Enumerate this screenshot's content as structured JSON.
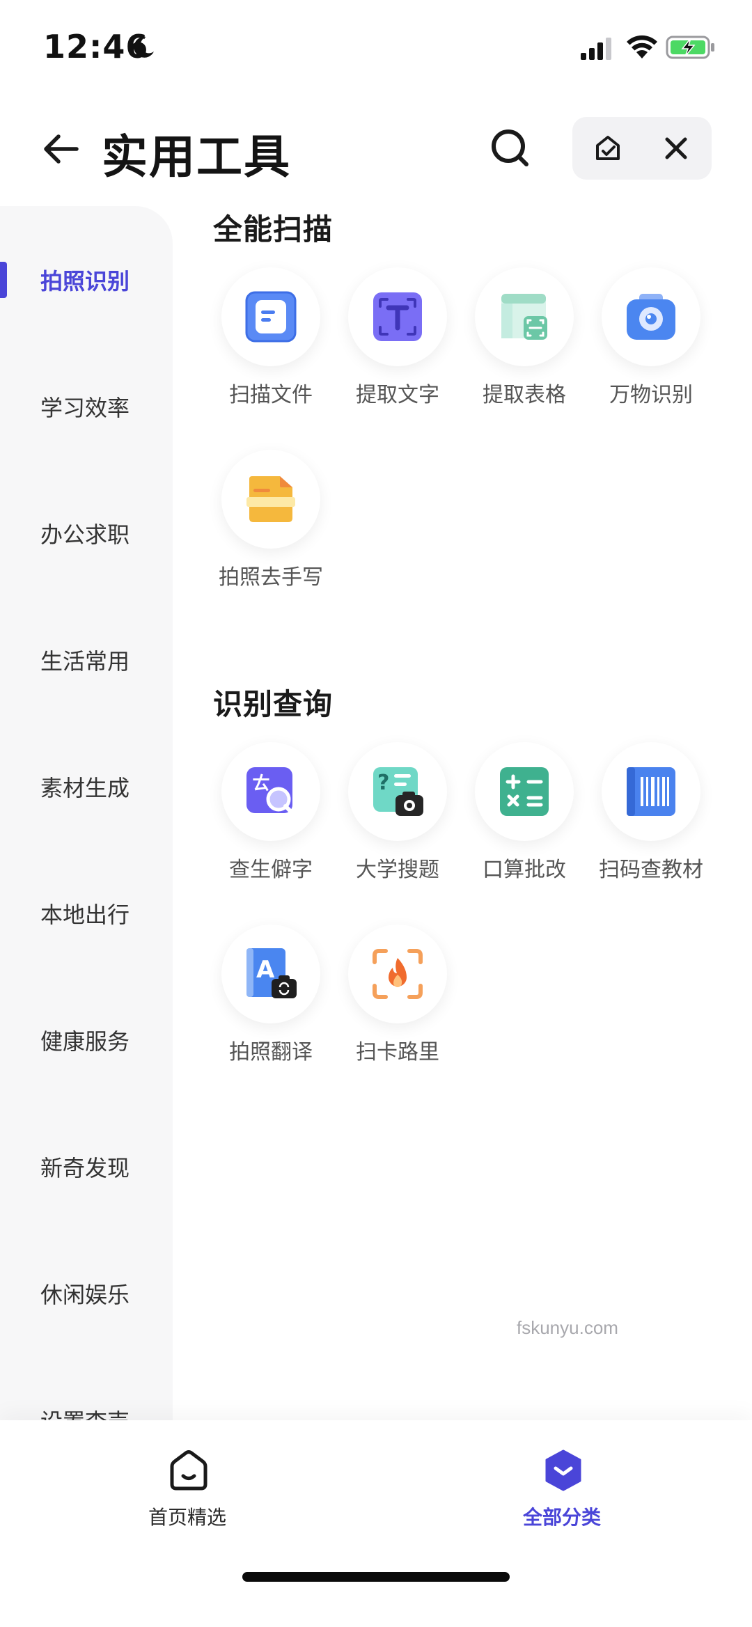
{
  "status_bar": {
    "time": "12:46"
  },
  "header": {
    "title": "实用工具"
  },
  "sidebar": {
    "items": [
      {
        "label": "拍照识别",
        "active": true
      },
      {
        "label": "学习效率"
      },
      {
        "label": "办公求职"
      },
      {
        "label": "生活常用"
      },
      {
        "label": "素材生成"
      },
      {
        "label": "本地出行"
      },
      {
        "label": "健康服务"
      },
      {
        "label": "新奇发现"
      },
      {
        "label": "休闲娱乐"
      },
      {
        "label": "设置查売"
      }
    ]
  },
  "sections": [
    {
      "title": "全能扫描",
      "tools": [
        {
          "label": "扫描文件",
          "icon": "scan-document-icon",
          "color": "#4a7cf0"
        },
        {
          "label": "提取文字",
          "icon": "extract-text-icon",
          "color": "#6b5ef0"
        },
        {
          "label": "提取表格",
          "icon": "extract-table-icon",
          "color": "#7fd3b8"
        },
        {
          "label": "万物识别",
          "icon": "camera-identify-icon",
          "color": "#4b86f0"
        },
        {
          "label": "拍照去手写",
          "icon": "remove-handwriting-icon",
          "color": "#f5b83d"
        }
      ]
    },
    {
      "title": "识别查询",
      "tools": [
        {
          "label": "查生僻字",
          "icon": "rare-character-icon",
          "color": "#6a5ef2"
        },
        {
          "label": "大学搜题",
          "icon": "college-search-icon",
          "color": "#4dc9b8"
        },
        {
          "label": "口算批改",
          "icon": "math-check-icon",
          "color": "#3fb18f"
        },
        {
          "label": "扫码查教材",
          "icon": "barcode-textbook-icon",
          "color": "#4a82ee"
        },
        {
          "label": "拍照翻译",
          "icon": "photo-translate-icon",
          "color": "#4a86f0"
        },
        {
          "label": "扫卡路里",
          "icon": "calorie-scan-icon",
          "color": "#f08a3c"
        }
      ]
    }
  ],
  "watermark": "fskunyu.com",
  "tabbar": {
    "tabs": [
      {
        "label": "首页精选",
        "icon": "home-icon",
        "active": false
      },
      {
        "label": "全部分类",
        "icon": "category-icon",
        "active": true
      }
    ]
  },
  "colors": {
    "accent": "#4a45d8",
    "sidebar_bg": "#f7f7f8"
  }
}
